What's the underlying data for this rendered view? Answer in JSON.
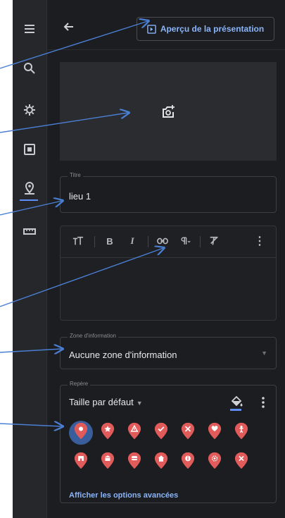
{
  "header": {
    "preview_label": "Aperçu de la présentation"
  },
  "title_field": {
    "legend": "Titre",
    "value": "lieu 1"
  },
  "info_field": {
    "legend": "Zone d'information",
    "value": "Aucune zone d'information"
  },
  "marker": {
    "legend": "Repère",
    "size_label": "Taille par défaut",
    "advanced_label": "Afficher les options avancées",
    "pin_color": "#e25b5b",
    "row1": [
      "pin-filled",
      "star",
      "warning",
      "check",
      "cutlery",
      "heart",
      "person"
    ],
    "row2": [
      "shop",
      "museum",
      "bus",
      "home",
      "info",
      "flower",
      "close"
    ]
  },
  "toolbar": {
    "tools": [
      "text-size-icon",
      "bold-icon",
      "italic-icon",
      "link-icon",
      "paragraph-icon",
      "clear-format-icon",
      "more-icon"
    ]
  },
  "colors": {
    "accent": "#8ab4f8",
    "rail_active": "#5d8ef5",
    "annotation_arrow": "#4a7fd4"
  }
}
